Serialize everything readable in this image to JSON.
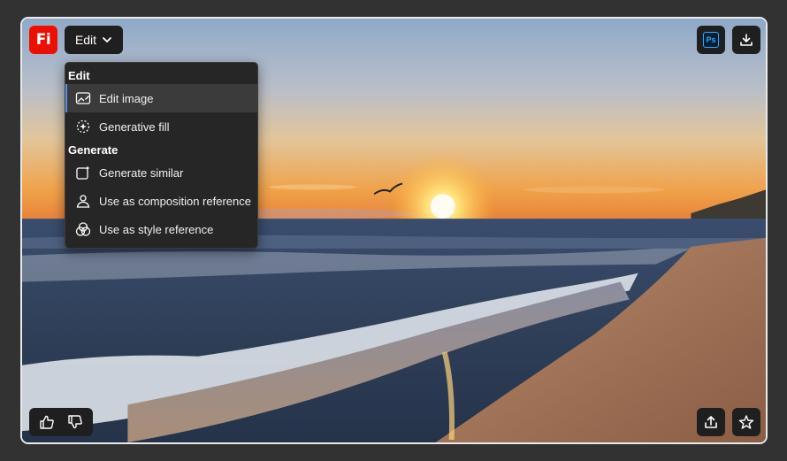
{
  "app": {
    "logo_text": "Fi"
  },
  "toolbar": {
    "edit_label": "Edit",
    "ps_label": "Ps"
  },
  "menu": {
    "sections": [
      {
        "title": "Edit",
        "items": [
          {
            "label": "Edit image",
            "icon": "edit-image-icon",
            "selected": true
          },
          {
            "label": "Generative fill",
            "icon": "generative-fill-icon"
          }
        ]
      },
      {
        "title": "Generate",
        "items": [
          {
            "label": "Generate similar",
            "icon": "generate-similar-icon"
          },
          {
            "label": "Use as composition reference",
            "icon": "composition-reference-icon"
          },
          {
            "label": "Use as style reference",
            "icon": "style-reference-icon"
          }
        ]
      }
    ]
  },
  "icons": {
    "top_right": [
      "photoshop-icon",
      "download-icon"
    ],
    "bottom_left": [
      "thumbs-up-icon",
      "thumbs-down-icon"
    ],
    "bottom_right": [
      "share-icon",
      "star-icon"
    ]
  },
  "colors": {
    "brand": "#eb1000",
    "accent": "#5b8de8",
    "menu_bg": "#262626",
    "ps_blue": "#31a8ff"
  }
}
